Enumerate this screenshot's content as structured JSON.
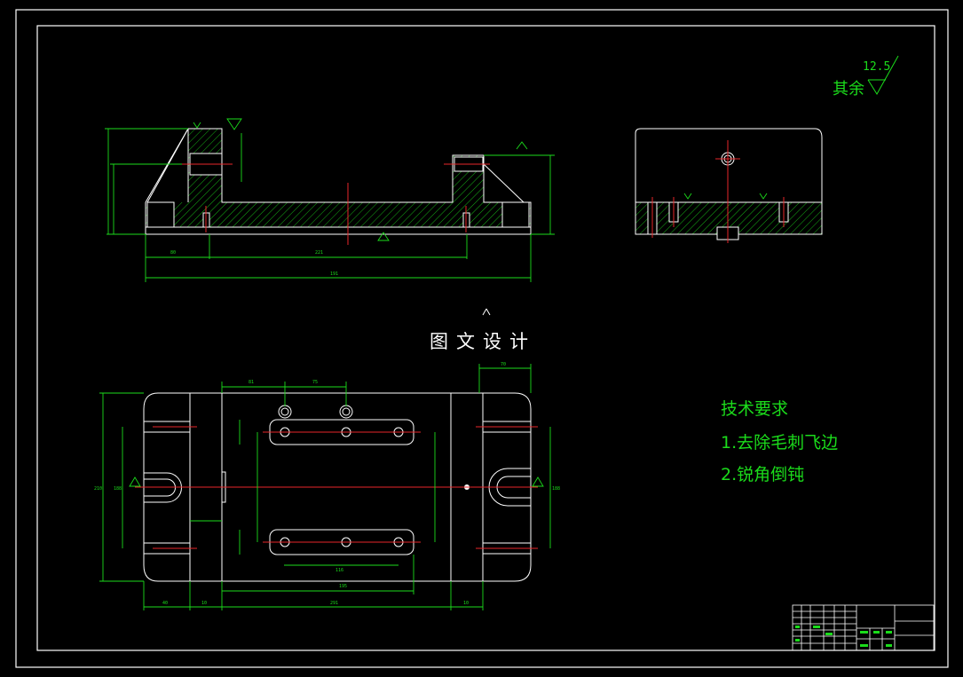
{
  "watermark": "图文设计",
  "roughness": {
    "prefix": "其余",
    "value": "12.5"
  },
  "requirements": {
    "title": "技术要求",
    "items": [
      "1.去除毛刺飞边",
      "2.锐角倒钝"
    ]
  },
  "dimensions": {
    "front_bottom_inner": "221",
    "front_bottom_total": "191",
    "front_left": "80",
    "top_a": "81",
    "top_b": "75",
    "top_c": "70",
    "top_d": "116",
    "top_e": "195",
    "top_total": "291",
    "top_left_a": "40",
    "top_left_b": "10",
    "top_right": "10",
    "top_height": "210",
    "top_height_inner": "188",
    "top_height_right": "188"
  },
  "colors": {
    "border": "#ffffff",
    "outline": "#ffffff",
    "dimension": "#1bdc1b",
    "centerline": "#e8262a",
    "hatch": "#1bdc1b",
    "watermark": "#ffffff"
  }
}
